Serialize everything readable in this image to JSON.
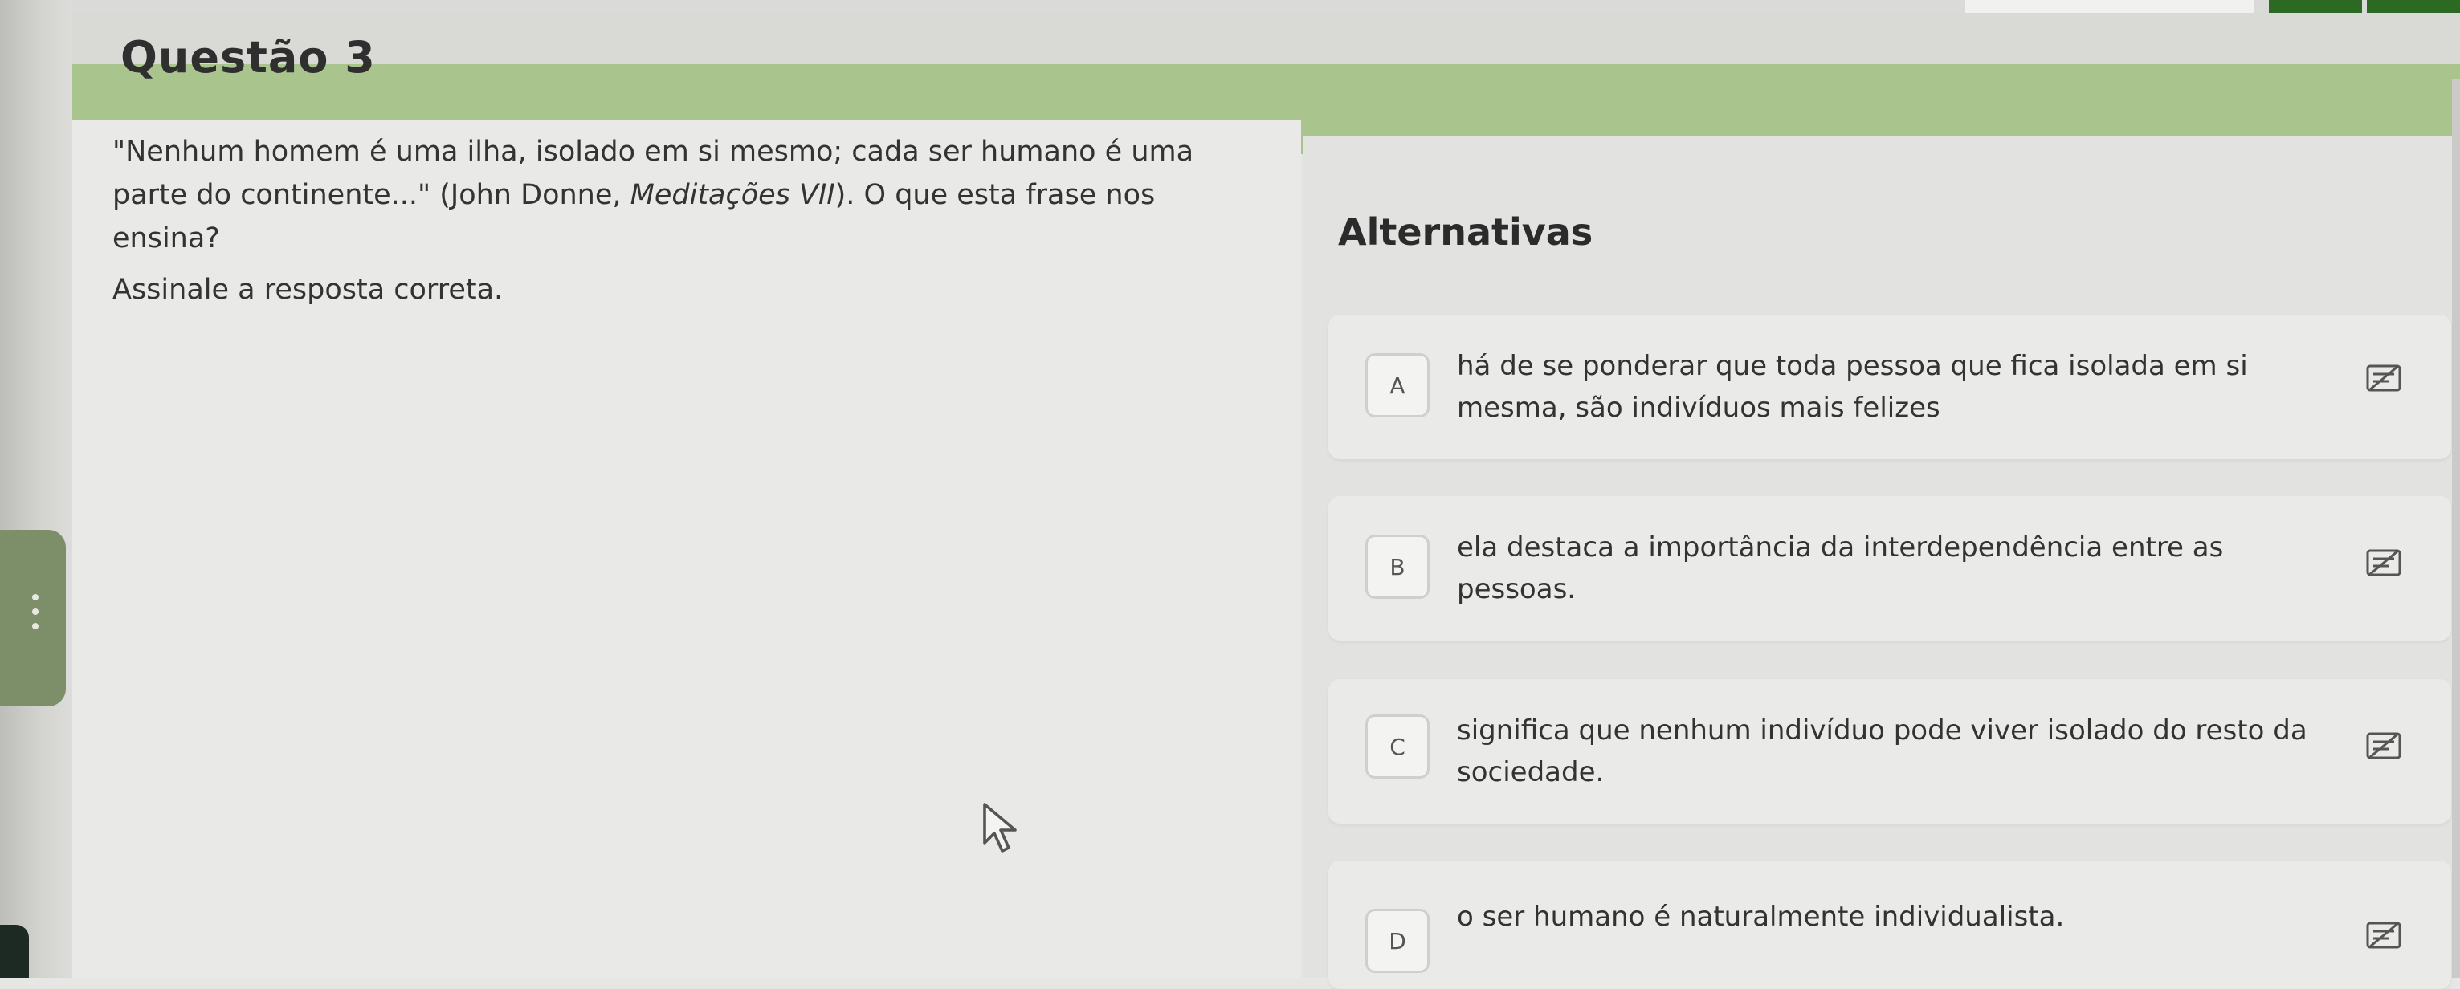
{
  "question": {
    "title": "Questão 3",
    "text_line1": "\"Nenhum homem é uma ilha, isolado em si mesmo; cada ser humano é uma",
    "text_line2_before": "parte do continente...\" (John Donne, ",
    "text_line2_italic": "Meditações VII",
    "text_line2_after": "). O que esta frase nos",
    "text_line3": "ensina?",
    "instruction": "Assinale a resposta correta."
  },
  "alternatives": {
    "title": "Alternativas",
    "items": [
      {
        "letter": "A",
        "line1": "há de se ponderar que toda pessoa que fica isolada em si",
        "line2": "mesma, são indivíduos mais felizes"
      },
      {
        "letter": "B",
        "line1": "ela destaca a importância da interdependência entre as",
        "line2": "pessoas."
      },
      {
        "letter": "C",
        "line1": "significa que nenhum indivíduo pode viver isolado do resto da",
        "line2": "sociedade."
      },
      {
        "letter": "D",
        "line1": "o ser humano é naturalmente individualista.",
        "line2": ""
      }
    ]
  },
  "icons": {
    "strike": "strike-through-icon",
    "cursor": "mouse-cursor-icon"
  },
  "colors": {
    "header_green": "#a9c48c",
    "side_green": "#7d8f69",
    "top_dark_green": "#2c6a23"
  }
}
